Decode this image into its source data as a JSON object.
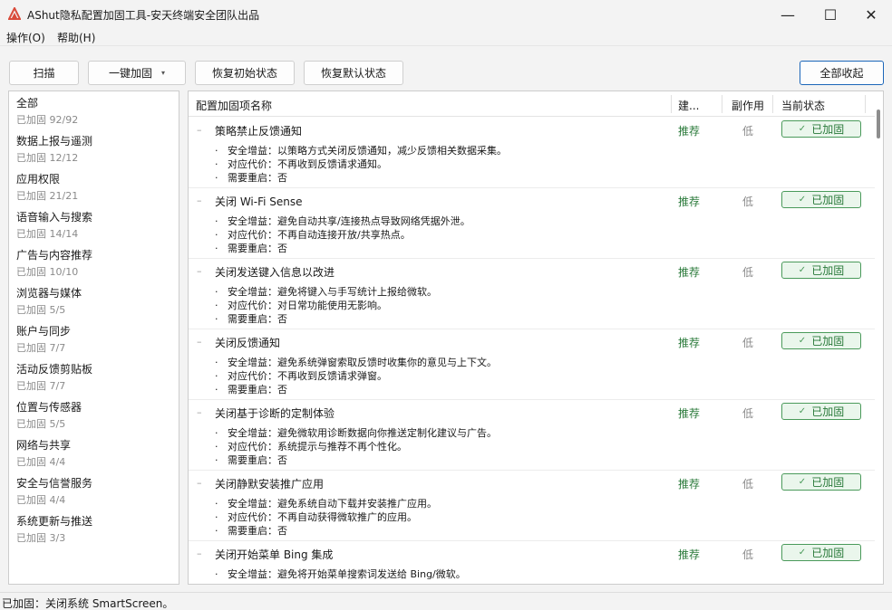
{
  "window": {
    "title": "AShut隐私配置加固工具-安天终端安全团队出品",
    "minimize": "—",
    "maximize": "☐",
    "close": "✕",
    "accent": "#d94a3a"
  },
  "menu": [
    {
      "label": "操作(O)"
    },
    {
      "label": "帮助(H)"
    }
  ],
  "toolbar": {
    "scan": "扫描",
    "harden_all": "一键加固",
    "harden_caret": "▾",
    "restore_initial": "恢复初始状态",
    "restore_default": "恢复默认状态",
    "collapse_all": "全部收起"
  },
  "categories": [
    {
      "name": "全部",
      "count": "已加固 92/92"
    },
    {
      "name": "数据上报与遥测",
      "count": "已加固 12/12"
    },
    {
      "name": "应用权限",
      "count": "已加固 21/21"
    },
    {
      "name": "语音输入与搜索",
      "count": "已加固 14/14"
    },
    {
      "name": "广告与内容推荐",
      "count": "已加固 10/10"
    },
    {
      "name": "浏览器与媒体",
      "count": "已加固 5/5"
    },
    {
      "name": "账户与同步",
      "count": "已加固 7/7"
    },
    {
      "name": "活动反馈剪贴板",
      "count": "已加固 7/7"
    },
    {
      "name": "位置与传感器",
      "count": "已加固 5/5"
    },
    {
      "name": "网络与共享",
      "count": "已加固 4/4"
    },
    {
      "name": "安全与信誉服务",
      "count": "已加固 4/4"
    },
    {
      "name": "系统更新与推送",
      "count": "已加固 3/3"
    }
  ],
  "table": {
    "headers": {
      "name": "配置加固项名称",
      "recommend": "建...",
      "side_effect": "副作用",
      "status": "当前状态"
    },
    "rows": [
      {
        "title": "策略禁止反馈通知",
        "recommend": "推荐",
        "side_effect": "低",
        "status": "已加固",
        "details": [
          "安全增益：以策略方式关闭反馈通知，减少反馈相关数据采集。",
          "对应代价：不再收到反馈请求通知。",
          "需要重启：否"
        ]
      },
      {
        "title": "关闭 Wi-Fi Sense",
        "recommend": "推荐",
        "side_effect": "低",
        "status": "已加固",
        "details": [
          "安全增益：避免自动共享/连接热点导致网络凭据外泄。",
          "对应代价：不再自动连接开放/共享热点。",
          "需要重启：否"
        ]
      },
      {
        "title": "关闭发送键入信息以改进",
        "recommend": "推荐",
        "side_effect": "低",
        "status": "已加固",
        "details": [
          "安全增益：避免将键入与手写统计上报给微软。",
          "对应代价：对日常功能使用无影响。",
          "需要重启：否"
        ]
      },
      {
        "title": "关闭反馈通知",
        "recommend": "推荐",
        "side_effect": "低",
        "status": "已加固",
        "details": [
          "安全增益：避免系统弹窗索取反馈时收集你的意见与上下文。",
          "对应代价：不再收到反馈请求弹窗。",
          "需要重启：否"
        ]
      },
      {
        "title": "关闭基于诊断的定制体验",
        "recommend": "推荐",
        "side_effect": "低",
        "status": "已加固",
        "details": [
          "安全增益：避免微软用诊断数据向你推送定制化建议与广告。",
          "对应代价：系统提示与推荐不再个性化。",
          "需要重启：否"
        ]
      },
      {
        "title": "关闭静默安装推广应用",
        "recommend": "推荐",
        "side_effect": "低",
        "status": "已加固",
        "details": [
          "安全增益：避免系统自动下载并安装推广应用。",
          "对应代价：不再自动获得微软推广的应用。",
          "需要重启：否"
        ]
      },
      {
        "title": "关闭开始菜单 Bing 集成",
        "recommend": "推荐",
        "side_effect": "低",
        "status": "已加固",
        "details": [
          "安全增益：避免将开始菜单搜索词发送给 Bing/微软。"
        ]
      }
    ]
  },
  "statusbar": {
    "text": "已加固：关闭系统 SmartScreen。"
  },
  "colors": {
    "recommend": "#2a7a3a",
    "badge_bg": "#eaf6ec",
    "badge_border": "#4a9a5a",
    "primary_border": "#1a65b8"
  }
}
